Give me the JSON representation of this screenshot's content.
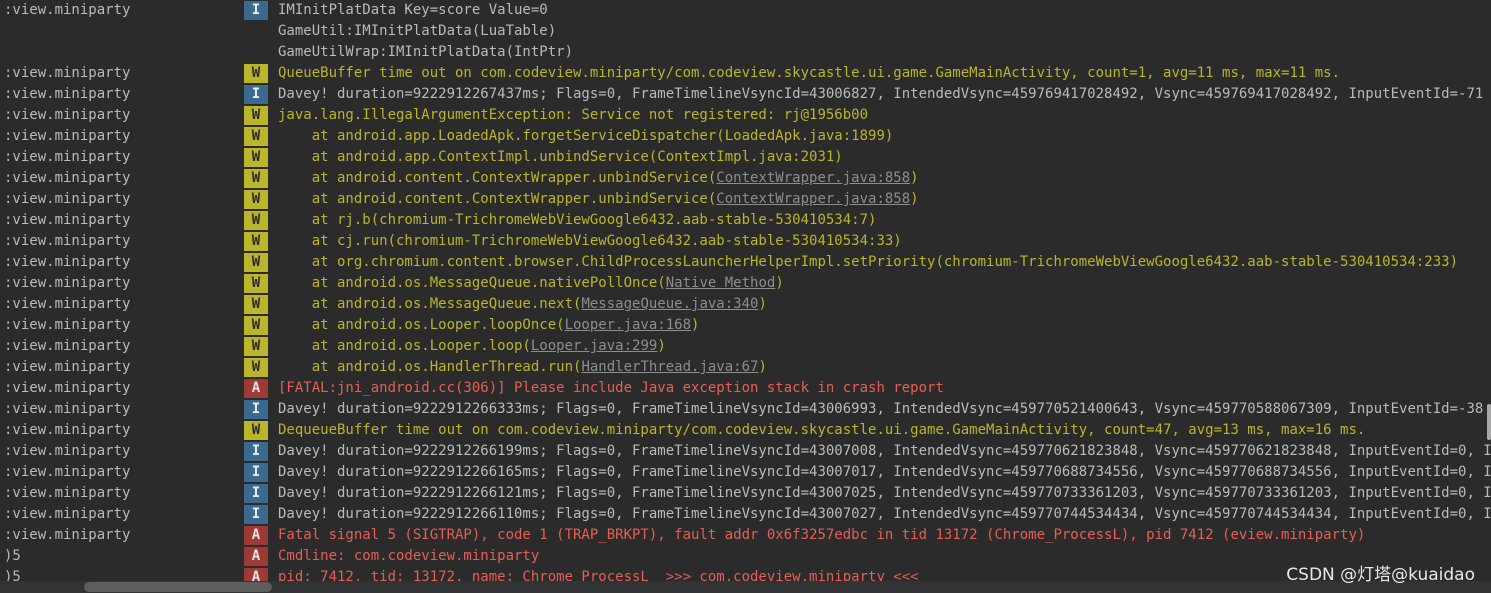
{
  "watermark": "CSDN @灯塔@kuaidao",
  "rows": [
    {
      "pkg": ":view.miniparty",
      "level": "I",
      "pre": "IMInitPlatData Key=score Value=0",
      "link": "",
      "post": ""
    },
    {
      "pkg": "",
      "level": "",
      "pre": "GameUtil:IMInitPlatData(LuaTable)",
      "link": "",
      "post": ""
    },
    {
      "pkg": "",
      "level": "",
      "pre": "GameUtilWrap:IMInitPlatData(IntPtr)",
      "link": "",
      "post": ""
    },
    {
      "pkg": ":view.miniparty",
      "level": "W",
      "pre": "QueueBuffer time out on com.codeview.miniparty/com.codeview.skycastle.ui.game.GameMainActivity, count=1, avg=11 ms, max=11 ms.",
      "link": "",
      "post": ""
    },
    {
      "pkg": ":view.miniparty",
      "level": "I",
      "pre": "Davey! duration=9222912267437ms; Flags=0, FrameTimelineVsyncId=43006827, IntendedVsync=459769417028492, Vsync=459769417028492, InputEventId=-71",
      "link": "",
      "post": ""
    },
    {
      "pkg": ":view.miniparty",
      "level": "W",
      "pre": "java.lang.IllegalArgumentException: Service not registered: rj@1956b00",
      "link": "",
      "post": ""
    },
    {
      "pkg": ":view.miniparty",
      "level": "W",
      "pre": "    at android.app.LoadedApk.forgetServiceDispatcher(LoadedApk.java:1899)",
      "link": "",
      "post": ""
    },
    {
      "pkg": ":view.miniparty",
      "level": "W",
      "pre": "    at android.app.ContextImpl.unbindService(ContextImpl.java:2031)",
      "link": "",
      "post": ""
    },
    {
      "pkg": ":view.miniparty",
      "level": "W",
      "pre": "    at android.content.ContextWrapper.unbindService(",
      "link": "ContextWrapper.java:858",
      "post": ")"
    },
    {
      "pkg": ":view.miniparty",
      "level": "W",
      "pre": "    at android.content.ContextWrapper.unbindService(",
      "link": "ContextWrapper.java:858",
      "post": ")"
    },
    {
      "pkg": ":view.miniparty",
      "level": "W",
      "pre": "    at rj.b(chromium-TrichromeWebViewGoogle6432.aab-stable-530410534:7)",
      "link": "",
      "post": ""
    },
    {
      "pkg": ":view.miniparty",
      "level": "W",
      "pre": "    at cj.run(chromium-TrichromeWebViewGoogle6432.aab-stable-530410534:33)",
      "link": "",
      "post": ""
    },
    {
      "pkg": ":view.miniparty",
      "level": "W",
      "pre": "    at org.chromium.content.browser.ChildProcessLauncherHelperImpl.setPriority(chromium-TrichromeWebViewGoogle6432.aab-stable-530410534:233)",
      "link": "",
      "post": ""
    },
    {
      "pkg": ":view.miniparty",
      "level": "W",
      "pre": "    at android.os.MessageQueue.nativePollOnce(",
      "link": "Native Method",
      "post": ")"
    },
    {
      "pkg": ":view.miniparty",
      "level": "W",
      "pre": "    at android.os.MessageQueue.next(",
      "link": "MessageQueue.java:340",
      "post": ")"
    },
    {
      "pkg": ":view.miniparty",
      "level": "W",
      "pre": "    at android.os.Looper.loopOnce(",
      "link": "Looper.java:168",
      "post": ")"
    },
    {
      "pkg": ":view.miniparty",
      "level": "W",
      "pre": "    at android.os.Looper.loop(",
      "link": "Looper.java:299",
      "post": ")"
    },
    {
      "pkg": ":view.miniparty",
      "level": "W",
      "pre": "    at android.os.HandlerThread.run(",
      "link": "HandlerThread.java:67",
      "post": ")"
    },
    {
      "pkg": ":view.miniparty",
      "level": "A",
      "pre": "[FATAL:jni_android.cc(306)] Please include Java exception stack in crash report",
      "link": "",
      "post": ""
    },
    {
      "pkg": ":view.miniparty",
      "level": "I",
      "pre": "Davey! duration=9222912266333ms; Flags=0, FrameTimelineVsyncId=43006993, IntendedVsync=459770521400643, Vsync=459770588067309, InputEventId=-38",
      "link": "",
      "post": ""
    },
    {
      "pkg": ":view.miniparty",
      "level": "W",
      "pre": "DequeueBuffer time out on com.codeview.miniparty/com.codeview.skycastle.ui.game.GameMainActivity, count=47, avg=13 ms, max=16 ms.",
      "link": "",
      "post": ""
    },
    {
      "pkg": ":view.miniparty",
      "level": "I",
      "pre": "Davey! duration=9222912266199ms; Flags=0, FrameTimelineVsyncId=43007008, IntendedVsync=459770621823848, Vsync=459770621823848, InputEventId=0, I",
      "link": "",
      "post": ""
    },
    {
      "pkg": ":view.miniparty",
      "level": "I",
      "pre": "Davey! duration=9222912266165ms; Flags=0, FrameTimelineVsyncId=43007017, IntendedVsync=459770688734556, Vsync=459770688734556, InputEventId=0, I",
      "link": "",
      "post": ""
    },
    {
      "pkg": ":view.miniparty",
      "level": "I",
      "pre": "Davey! duration=9222912266121ms; Flags=0, FrameTimelineVsyncId=43007025, IntendedVsync=459770733361203, Vsync=459770733361203, InputEventId=0, I",
      "link": "",
      "post": ""
    },
    {
      "pkg": ":view.miniparty",
      "level": "I",
      "pre": "Davey! duration=9222912266110ms; Flags=0, FrameTimelineVsyncId=43007027, IntendedVsync=459770744534434, Vsync=459770744534434, InputEventId=0, I",
      "link": "",
      "post": ""
    },
    {
      "pkg": ":view.miniparty",
      "level": "A",
      "pre": "Fatal signal 5 (SIGTRAP), code 1 (TRAP_BRKPT), fault addr 0x6f3257edbc in tid 13172 (Chrome_ProcessL), pid 7412 (eview.miniparty)",
      "link": "",
      "post": ""
    },
    {
      "pkg": ")5",
      "level": "A",
      "pre": "Cmdline: com.codeview.miniparty",
      "link": "",
      "post": ""
    },
    {
      "pkg": ")5",
      "level": "A",
      "pre": "pid: 7412, tid: 13172, name: Chrome_ProcessL  >>> com.codeview.miniparty <<<",
      "link": "",
      "post": ""
    }
  ]
}
